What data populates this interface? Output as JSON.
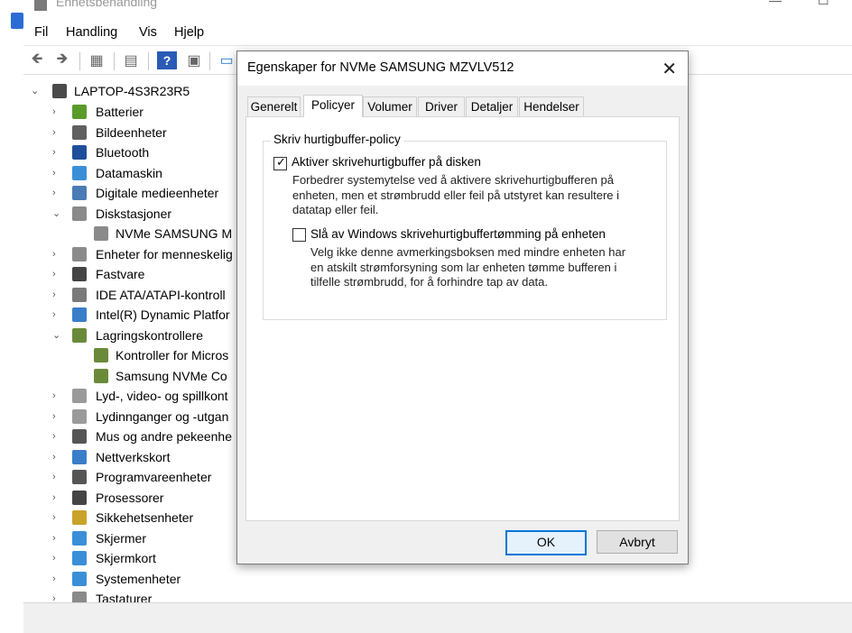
{
  "main_window": {
    "title": "Enhetsbehandling",
    "menu": [
      "Fil",
      "Handling",
      "Vis",
      "Hjelp"
    ]
  },
  "tree": {
    "root": "LAPTOP-4S3R23R5",
    "items": [
      {
        "label": "Batterier",
        "expanded": false,
        "color": "#5a9a2a"
      },
      {
        "label": "Bildeenheter",
        "expanded": false,
        "color": "#606060"
      },
      {
        "label": "Bluetooth",
        "expanded": false,
        "color": "#1f4e9a"
      },
      {
        "label": "Datamaskin",
        "expanded": false,
        "color": "#3b8fd6"
      },
      {
        "label": "Digitale medieenheter",
        "expanded": false,
        "color": "#4a7bb5"
      },
      {
        "label": "Diskstasjoner",
        "expanded": true,
        "color": "#8a8a8a"
      },
      {
        "label": "NVMe SAMSUNG M",
        "child": true,
        "color": "#8a8a8a"
      },
      {
        "label": "Enheter for menneskelig",
        "expanded": false,
        "color": "#8a8a8a"
      },
      {
        "label": "Fastvare",
        "expanded": false,
        "color": "#444444"
      },
      {
        "label": "IDE ATA/ATAPI-kontroll",
        "expanded": false,
        "color": "#7a7a7a"
      },
      {
        "label": "Intel(R) Dynamic Platfor",
        "expanded": false,
        "color": "#3a7dc9"
      },
      {
        "label": "Lagringskontrollere",
        "expanded": true,
        "color": "#6a8a3a"
      },
      {
        "label": "Kontroller for Micros",
        "child": true,
        "color": "#6a8a3a"
      },
      {
        "label": "Samsung NVMe Co",
        "child": true,
        "color": "#6a8a3a"
      },
      {
        "label": "Lyd-, video- og spillkont",
        "expanded": false,
        "color": "#9a9a9a"
      },
      {
        "label": "Lydinnganger og -utgan",
        "expanded": false,
        "color": "#9a9a9a"
      },
      {
        "label": "Mus og andre pekeenhe",
        "expanded": false,
        "color": "#555555"
      },
      {
        "label": "Nettverkskort",
        "expanded": false,
        "color": "#3a7dc9"
      },
      {
        "label": "Programvareenheter",
        "expanded": false,
        "color": "#555555"
      },
      {
        "label": "Prosessorer",
        "expanded": false,
        "color": "#444444"
      },
      {
        "label": "Sikkehetsenheter",
        "expanded": false,
        "color": "#c9a22a"
      },
      {
        "label": "Skjermer",
        "expanded": false,
        "color": "#3b8fd6"
      },
      {
        "label": "Skjermkort",
        "expanded": false,
        "color": "#3b8fd6"
      },
      {
        "label": "Systemenheter",
        "expanded": false,
        "color": "#3b8fd6"
      },
      {
        "label": "Tastaturer",
        "expanded": false,
        "color": "#8a8a8a"
      }
    ]
  },
  "dialog": {
    "title": "Egenskaper for NVMe SAMSUNG MZVLV512",
    "tabs": [
      "Generelt",
      "Policyer",
      "Volumer",
      "Driver",
      "Detaljer",
      "Hendelser"
    ],
    "active_tab": "Policyer",
    "group_label": "Skriv hurtigbuffer-policy",
    "option1": {
      "label": "Aktiver skrivehurtigbuffer på disken",
      "checked": true,
      "desc": [
        "Forbedrer systemytelse ved å aktivere skrivehurtigbufferen på",
        "enheten, men et strømbrudd eller feil på utstyret kan resultere i",
        "datatap eller feil."
      ]
    },
    "option2": {
      "label": "Slå av Windows skrivehurtigbuffertømming på enheten",
      "checked": false,
      "desc": [
        "Velg ikke denne avmerkingsboksen med mindre enheten har",
        "en atskilt strømforsyning som lar enheten tømme bufferen i",
        "tilfelle strømbrudd, for å forhindre tap av data."
      ]
    },
    "ok_label": "OK",
    "cancel_label": "Avbryt",
    "accent": "#0078d7"
  }
}
